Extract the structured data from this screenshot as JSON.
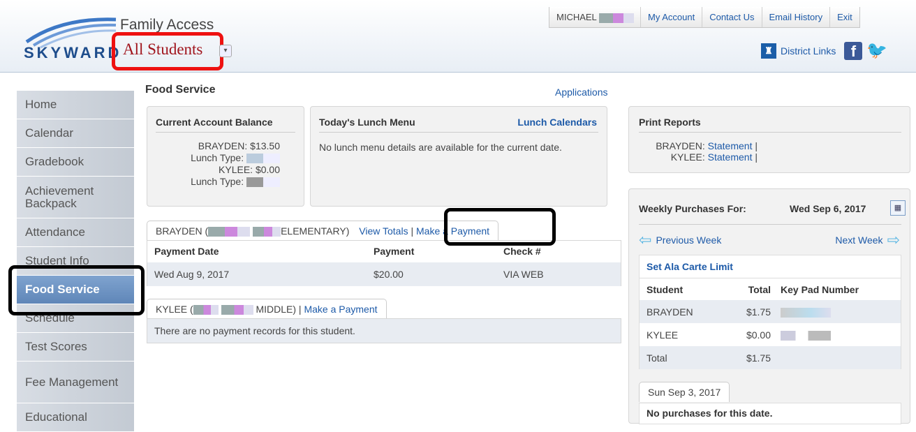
{
  "header": {
    "logo_text": "SKYWARD",
    "app_title": "Family Access",
    "student_selector": "All Students",
    "user_name": "MICHAEL",
    "nav": [
      "My Account",
      "Contact Us",
      "Email History",
      "Exit"
    ],
    "district_links": "District Links"
  },
  "sidebar": {
    "items": [
      "Home",
      "Calendar",
      "Gradebook",
      "Achievement Backpack",
      "Attendance",
      "Student Info",
      "Food Service",
      "Schedule",
      "Test Scores",
      "Fee Management",
      "Educational"
    ],
    "active": "Food Service"
  },
  "page": {
    "title": "Food Service",
    "applications_link": "Applications"
  },
  "balance": {
    "heading": "Current Account Balance",
    "entries": [
      {
        "name": "BRAYDEN:",
        "amount": "$13.50",
        "lunch_label": "Lunch Type:"
      },
      {
        "name": "KYLEE:",
        "amount": "$0.00",
        "lunch_label": "Lunch Type:"
      }
    ]
  },
  "lunch_menu": {
    "heading": "Today's Lunch Menu",
    "calendars_link": "Lunch Calendars",
    "message": "No lunch menu details are available for the current date."
  },
  "print_reports": {
    "heading": "Print Reports",
    "entries": [
      {
        "name": "BRAYDEN:",
        "link": "Statement"
      },
      {
        "name": "KYLEE:",
        "link": "Statement"
      }
    ]
  },
  "brayden_payments": {
    "tab_prefix": "BRAYDEN (",
    "tab_suffix": "ELEMENTARY)",
    "view_totals": "View Totals",
    "make_payment": "Make a Payment",
    "columns": [
      "Payment Date",
      "Payment",
      "Check #"
    ],
    "rows": [
      [
        "Wed Aug 9, 2017",
        "$20.00",
        "VIA WEB"
      ]
    ]
  },
  "kylee_payments": {
    "tab_prefix": "KYLEE (",
    "tab_suffix": "MIDDLE)",
    "make_payment": "Make a Payment",
    "message": "There are no payment records for this student."
  },
  "weekly": {
    "heading": "Weekly Purchases For:",
    "date": "Wed Sep 6, 2017",
    "prev": "Previous Week",
    "next": "Next Week",
    "set_limit": "Set Ala Carte Limit",
    "columns": [
      "Student",
      "Total",
      "Key Pad Number"
    ],
    "rows": [
      [
        "BRAYDEN",
        "$1.75"
      ],
      [
        "KYLEE",
        "$0.00"
      ],
      [
        "Total",
        "$1.75"
      ]
    ],
    "day_tab": "Sun Sep 3, 2017",
    "day_message": "No purchases for this date."
  }
}
